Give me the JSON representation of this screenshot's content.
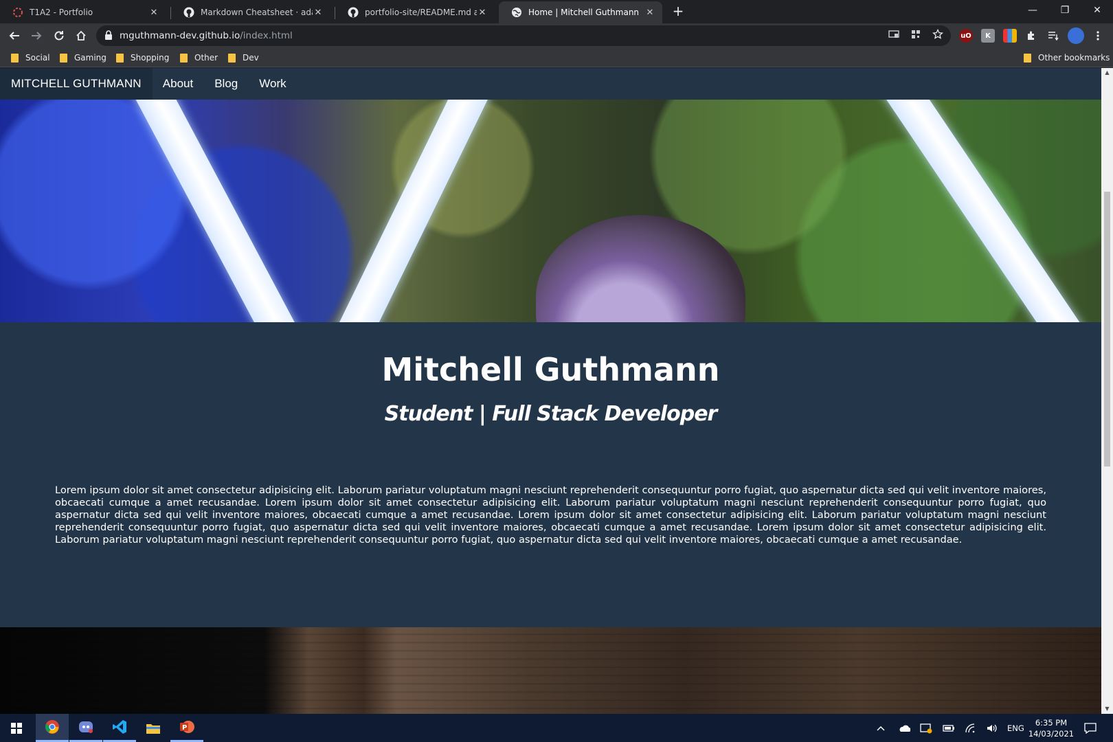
{
  "browser": {
    "tabs": [
      {
        "title": "T1A2 - Portfolio",
        "favicon": "loading-spinner-icon"
      },
      {
        "title": "Markdown Cheatsheet · adam-p/",
        "favicon": "github-icon"
      },
      {
        "title": "portfolio-site/README.md at ma",
        "favicon": "github-icon"
      },
      {
        "title": "Home | Mitchell Guthmann",
        "favicon": "globe-icon",
        "active": true
      }
    ],
    "new_tab": "+",
    "address": {
      "host": "mguthmann-dev.github.io",
      "path": "/index.html"
    },
    "bookmarks": [
      "Social",
      "Gaming",
      "Shopping",
      "Other",
      "Dev"
    ],
    "other_bookmarks": "Other bookmarks",
    "extensions": [
      "ublock-icon",
      "extension-k-icon",
      "extension-cam-icon",
      "puzzle-icon",
      "reading-list-icon",
      "profile-avatar"
    ]
  },
  "site": {
    "brand": "MITCHELL GUTHMANN",
    "nav": [
      "About",
      "Blog",
      "Work"
    ],
    "hero_alt": "hero-photo",
    "name": "Mitchell Guthmann",
    "role": "Student | Full Stack Developer",
    "intro": "Lorem ipsum dolor sit amet consectetur adipisicing elit. Laborum pariatur voluptatum magni nesciunt reprehenderit consequuntur porro fugiat, quo aspernatur dicta sed qui velit inventore maiores, obcaecati cumque a amet recusandae. Lorem ipsum dolor sit amet consectetur adipisicing elit. Laborum pariatur voluptatum magni nesciunt reprehenderit consequuntur porro fugiat, quo aspernatur dicta sed qui velit inventore maiores, obcaecati cumque a amet recusandae. Lorem ipsum dolor sit amet consectetur adipisicing elit. Laborum pariatur voluptatum magni nesciunt reprehenderit consequuntur porro fugiat, quo aspernatur dicta sed qui velit inventore maiores, obcaecati cumque a amet recusandae. Lorem ipsum dolor sit amet consectetur adipisicing elit. Laborum pariatur voluptatum magni nesciunt reprehenderit consequuntur porro fugiat, quo aspernatur dicta sed qui velit inventore maiores, obcaecati cumque a amet recusandae.",
    "colors": {
      "background": "#233548",
      "nav": "#223446",
      "brand_bg": "#1c2c3c",
      "text": "#ffffff"
    }
  },
  "taskbar": {
    "apps": [
      "windows-start-icon",
      "chrome-icon",
      "discord-icon",
      "vscode-icon",
      "file-explorer-icon",
      "powerpoint-icon"
    ],
    "language": "ENG",
    "time": "6:35 PM",
    "date": "14/03/2021"
  }
}
